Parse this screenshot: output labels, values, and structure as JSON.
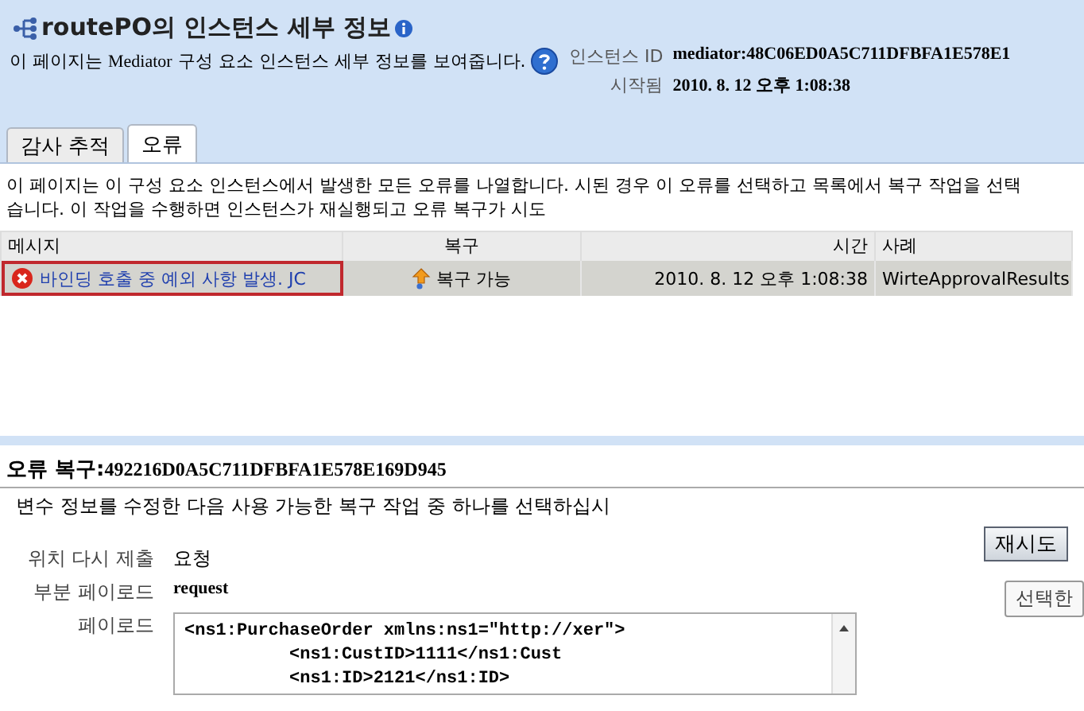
{
  "header": {
    "title": "routePO의 인스턴스 세부 정보",
    "subtitle_before": "이 페이지는",
    "subtitle_product": "Mediator",
    "subtitle_after": "구성 요소 인스턴스 세부 정보를 보여줍니다.",
    "info": [
      {
        "label": "인스턴스 ID",
        "value": "mediator:48C06ED0A5C711DFBFA1E578E1"
      },
      {
        "label": "시작됨",
        "value": "2010. 8. 12 오후 1:08:38"
      }
    ]
  },
  "tabs": [
    {
      "label": "감사 추적",
      "selected": false
    },
    {
      "label": "오류",
      "selected": true
    }
  ],
  "description": [
    "이 페이지는 이 구성 요소 인스턴스에서 발생한 모든 오류를 나열합니다. 시된 경우 이 오류를 선택하고 목록에서 복구 작업을 선택",
    "습니다. 이 작업을 수행하면 인스턴스가 재실행되고 오류 복구가 시도"
  ],
  "table": {
    "columns": [
      "메시지",
      "복구",
      "시간",
      "사례"
    ],
    "rows": [
      {
        "message": "바인딩 호출 중 예외 사항 발생. JC",
        "recovery": "복구 가능",
        "time": "2010. 8. 12 오후 1:08:38",
        "instance": "WirteApprovalResults",
        "selected": true
      }
    ]
  },
  "recovery": {
    "title": "오류 복구:",
    "id": "492216D0A5C711DFBFA1E578E169D945",
    "instruction": "변수 정보를 수정한 다음 사용 가능한 복구 작업 중 하나를 선택하십시",
    "button": "재시도",
    "tooltip": "선택한",
    "fields": [
      {
        "label": "위치 다시 제출",
        "value": "요청"
      },
      {
        "label": "부분 페이로드",
        "value": "request"
      }
    ],
    "payload_label": "페이로드",
    "payload": [
      "<ns1:PurchaseOrder xmlns:ns1=\"http://xer\">",
      "          <ns1:CustID>1111</ns1:Cust",
      "          <ns1:ID>2121</ns1:ID>"
    ]
  }
}
